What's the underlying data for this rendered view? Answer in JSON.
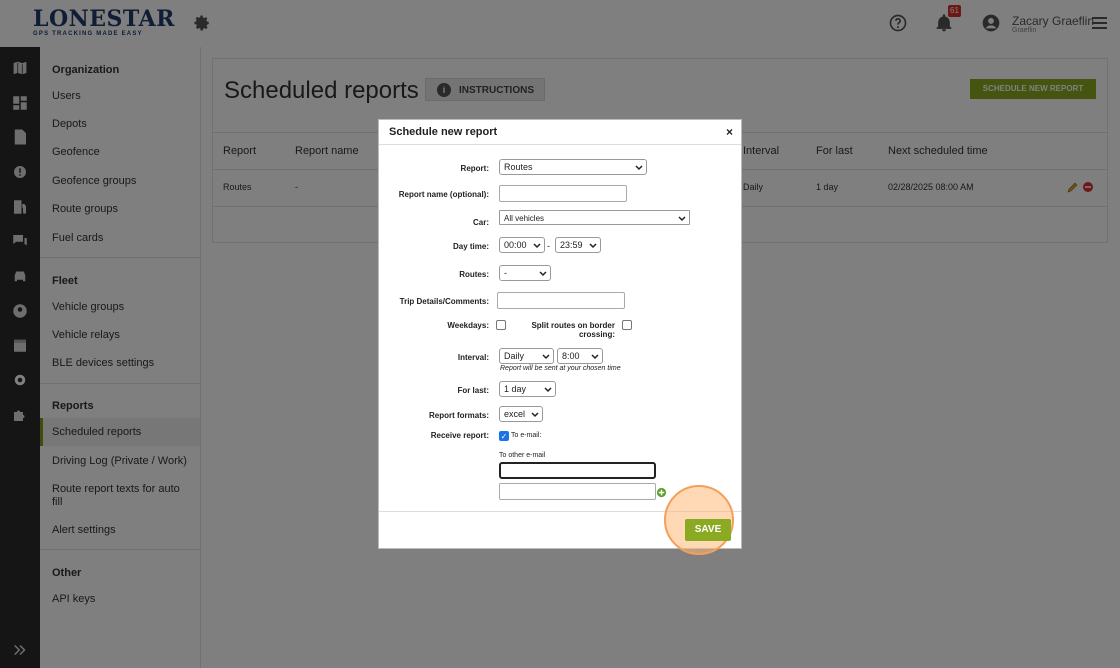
{
  "header": {
    "logo_word": "LONESTAR",
    "logo_sub": "TRACKING",
    "logo_tagline": "GPS TRACKING MADE EASY",
    "notification_count": "61",
    "user_name": "Zacary Graeflin",
    "user_sub": "Graeflin"
  },
  "sidebar": {
    "sections": [
      {
        "title": "Organization",
        "items": [
          "Users",
          "Depots",
          "Geofence",
          "Geofence groups",
          "Route groups",
          "Fuel cards"
        ]
      },
      {
        "title": "Fleet",
        "items": [
          "Vehicle groups",
          "Vehicle relays",
          "BLE devices settings"
        ]
      },
      {
        "title": "Reports",
        "items": [
          "Scheduled reports",
          "Driving Log (Private / Work)",
          "Route report texts for auto fill",
          "Alert settings"
        ]
      },
      {
        "title": "Other",
        "items": [
          "API keys"
        ]
      }
    ],
    "active_item": "Scheduled reports"
  },
  "page": {
    "title": "Scheduled reports",
    "instructions_label": "INSTRUCTIONS",
    "schedule_button": "SCHEDULE NEW REPORT",
    "columns": [
      "Report",
      "Report name",
      "Interval",
      "For last",
      "Next scheduled time"
    ],
    "rows": [
      {
        "report": "Routes",
        "name": "-",
        "interval": "Daily",
        "for_last": "1 day",
        "next": "02/28/2025 08:00 AM"
      }
    ]
  },
  "modal": {
    "title": "Schedule new report",
    "close": "×",
    "labels": {
      "report": "Report:",
      "report_name": "Report name (optional):",
      "car": "Car:",
      "day_time": "Day time:",
      "routes": "Routes:",
      "trip_details": "Trip Details/Comments:",
      "weekdays": "Weekdays:",
      "split_routes": "Split routes on border crossing:",
      "interval": "Interval:",
      "for_last": "For last:",
      "report_formats": "Report formats:",
      "receive_report": "Receive report:"
    },
    "values": {
      "report": "Routes",
      "car": "All vehicles",
      "time_from": "00:00",
      "time_sep": "-",
      "time_to": "23:59",
      "routes": "-",
      "interval": "Daily",
      "interval_time": "8:00",
      "interval_note": "Report will be sent at your chosen time",
      "for_last": "1 day",
      "format": "excel",
      "to_email": "To e-mail:",
      "to_other_email": "To other e-mail"
    },
    "save_label": "SAVE"
  },
  "colors": {
    "accent_green": "#8aaa21",
    "rail": "#2b2b2b",
    "badge_red": "#d9302c",
    "highlight": "#f2a05a"
  }
}
